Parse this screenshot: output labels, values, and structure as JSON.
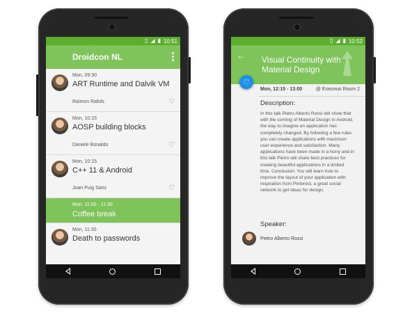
{
  "left_phone": {
    "status": {
      "time": "10:51"
    },
    "app_bar": {
      "title": "Droidcon NL"
    },
    "sessions": [
      {
        "time": "Mon, 09:30",
        "title": "ART Runtime and Dalvik VM",
        "speaker": "Raimon Rafols"
      },
      {
        "time": "Mon, 10:15",
        "title": "AOSP building blocks",
        "speaker": "Daniele Bonaldo"
      },
      {
        "time": "Mon, 10:15",
        "title": "C++ 11 & Android",
        "speaker": "Joan Puig Sanz"
      },
      {
        "time": "Mon, 11:00 - 11:30",
        "title": "Coffee break"
      },
      {
        "time": "Mon, 11:30",
        "title": "Death to passwords"
      }
    ]
  },
  "right_phone": {
    "status": {
      "time": "10:52"
    },
    "detail": {
      "title": "Visual Continuity with Material Design",
      "time": "Mon, 12:15 - 13:00",
      "room": "@ Erasmus Room 2",
      "description_label": "Description:",
      "description": "In this talk Pietro Alberto Rossi will show that with the coming of Material Design in Android, the way to imagine an application has completely changed. By following a few rules you can create applications with maximum user experience and satisfaction. Many applications have been made in a hurry and in this talk Pietro will share best practices for creating beautiful applications in a limited time.   Conclusion: You will learn how to improve the layout of your application with inspiration from Pinterest, a great social network to get ideas for design.",
      "speaker_label": "Speaker:",
      "speaker": "Pietro Alberto Rossi"
    }
  },
  "colors": {
    "primary": "#7ec45a",
    "primary_dark": "#5cae2f",
    "accent": "#1e90e6"
  },
  "icons": [
    "overflow-menu-icon",
    "heart-icon",
    "back-arrow-icon",
    "nav-back-icon",
    "nav-home-icon",
    "nav-recents-icon",
    "wifi-icon",
    "signal-icon",
    "battery-icon"
  ]
}
